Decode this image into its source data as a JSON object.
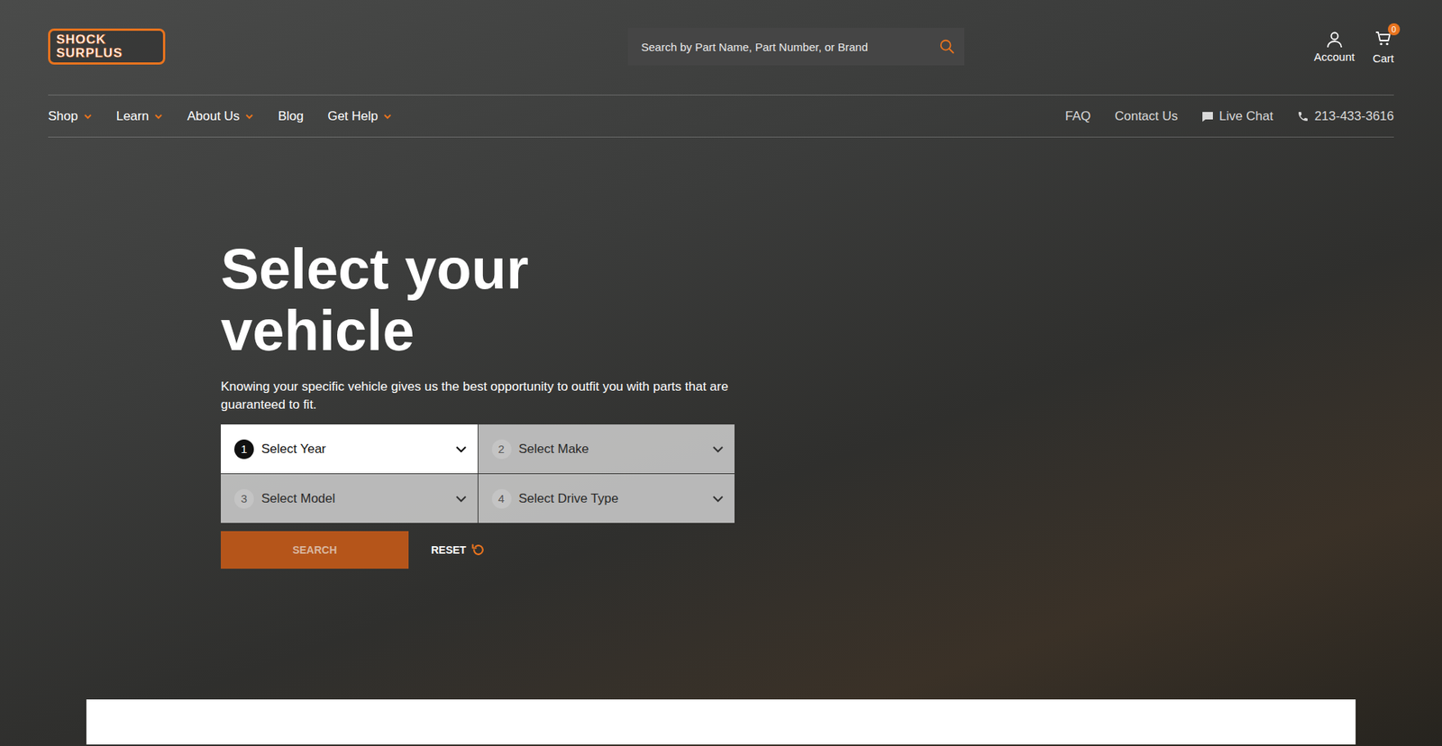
{
  "header": {
    "logo": {
      "lines": [
        "SHOCK",
        "SURPLUS"
      ]
    },
    "search": {
      "placeholder": "Search by Part Name, Part Number, or Brand"
    },
    "account": {
      "label": "Account"
    },
    "cart": {
      "label": "Cart",
      "count": "0"
    }
  },
  "nav": {
    "left": [
      {
        "label": "Shop",
        "dropdown": true
      },
      {
        "label": "Learn",
        "dropdown": true
      },
      {
        "label": "About Us",
        "dropdown": true
      },
      {
        "label": "Blog",
        "dropdown": false
      },
      {
        "label": "Get Help",
        "dropdown": true
      }
    ],
    "right": [
      {
        "label": "FAQ",
        "kind": "link"
      },
      {
        "label": "Contact Us",
        "kind": "link"
      },
      {
        "label": "Live Chat",
        "kind": "chat"
      },
      {
        "label": "213-433-3616",
        "kind": "phone"
      }
    ]
  },
  "hero": {
    "title": "Select your vehicle",
    "subtitle": "Knowing your specific vehicle gives us the best opportunity to outfit you with parts that are guaranteed to fit.",
    "selects": [
      {
        "step": "1",
        "label": "Select Year",
        "disabled": false
      },
      {
        "step": "2",
        "label": "Select Make",
        "disabled": true
      },
      {
        "step": "3",
        "label": "Select Model",
        "disabled": true
      },
      {
        "step": "4",
        "label": "Select Drive Type",
        "disabled": true
      }
    ],
    "search_button": {
      "label": "SEARCH",
      "disabled": true
    },
    "reset": {
      "label": "RESET"
    }
  }
}
